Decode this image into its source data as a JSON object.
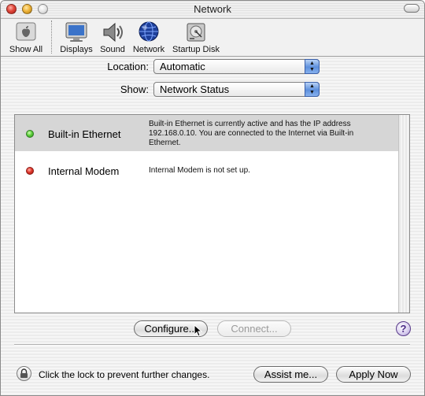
{
  "window": {
    "title": "Network"
  },
  "toolbar": {
    "items": [
      {
        "label": "Show All",
        "icon": "apple-icon"
      },
      {
        "label": "Displays",
        "icon": "display-icon"
      },
      {
        "label": "Sound",
        "icon": "speaker-icon"
      },
      {
        "label": "Network",
        "icon": "globe-icon"
      },
      {
        "label": "Startup Disk",
        "icon": "hard-disk-icon"
      }
    ]
  },
  "location": {
    "label": "Location:",
    "value": "Automatic"
  },
  "show": {
    "label": "Show:",
    "value": "Network Status"
  },
  "ports": [
    {
      "name": "Built-in Ethernet",
      "status": "active",
      "status_color": "#4fc232",
      "description": "Built-in Ethernet is currently active and has the IP address 192.168.0.10. You are connected to the Internet via Built-in Ethernet."
    },
    {
      "name": "Internal Modem",
      "status": "not-setup",
      "status_color": "#d9342a",
      "description": "Internal Modem is not set up."
    }
  ],
  "buttons": {
    "configure": "Configure...",
    "connect": "Connect...",
    "help": "?",
    "assist": "Assist me...",
    "apply": "Apply Now"
  },
  "lock": {
    "text": "Click the lock to prevent further changes."
  }
}
